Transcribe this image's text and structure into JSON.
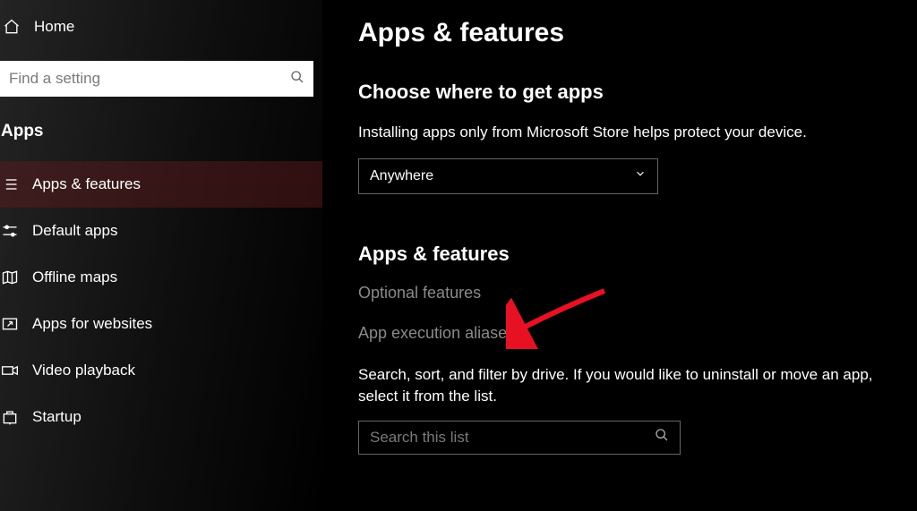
{
  "sidebar": {
    "home_label": "Home",
    "search_placeholder": "Find a setting",
    "category_label": "Apps",
    "items": [
      {
        "label": "Apps & features"
      },
      {
        "label": "Default apps"
      },
      {
        "label": "Offline maps"
      },
      {
        "label": "Apps for websites"
      },
      {
        "label": "Video playback"
      },
      {
        "label": "Startup"
      }
    ]
  },
  "main": {
    "page_title": "Apps & features",
    "section1": {
      "heading": "Choose where to get apps",
      "description": "Installing apps only from Microsoft Store helps protect your device.",
      "dropdown_value": "Anywhere"
    },
    "section2": {
      "heading": "Apps & features",
      "link_optional": "Optional features",
      "link_aliases": "App execution aliases",
      "info": "Search, sort, and filter by drive. If you would like to uninstall or move an app, select it from the list.",
      "list_search_placeholder": "Search this list"
    }
  }
}
